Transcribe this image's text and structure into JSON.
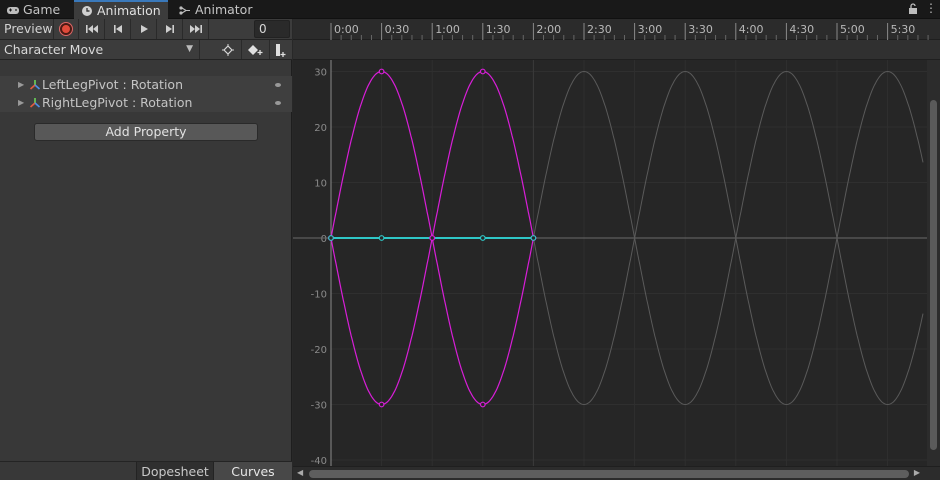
{
  "tabs": [
    {
      "label": "Game",
      "icon": "gamepad-icon",
      "active": false
    },
    {
      "label": "Animation",
      "icon": "clock-icon",
      "active": true
    },
    {
      "label": "Animator",
      "icon": "animator-graph-icon",
      "active": false
    }
  ],
  "window_menu": "⋮",
  "controls": {
    "preview_label": "Preview",
    "frame_value": "0",
    "buttons": [
      "record-icon",
      "first-keyframe-icon",
      "previous-keyframe-icon",
      "play-icon",
      "next-keyframe-icon",
      "last-keyframe-icon"
    ]
  },
  "clip": {
    "selected": "Character Move",
    "key_buttons": [
      "filter-keyframes-icon",
      "add-keyframe-icon",
      "add-event-icon"
    ]
  },
  "properties": [
    {
      "label": "LeftLegPivot : Rotation",
      "icon": "transform-axes-icon"
    },
    {
      "label": "RightLegPivot : Rotation",
      "icon": "transform-axes-icon"
    }
  ],
  "add_property_label": "Add Property",
  "bottom_tabs": {
    "dopesheet": "Dopesheet",
    "curves": "Curves",
    "active": "Curves"
  },
  "timeline": {
    "labels": [
      "0:00",
      "0:30",
      "1:00",
      "1:30",
      "2:00",
      "2:30",
      "3:00",
      "3:30",
      "4:00",
      "4:30",
      "5:00",
      "5:30"
    ]
  },
  "y_axis_labels": [
    "30",
    "20",
    "10",
    "0",
    "-10",
    "-20",
    "-30",
    "-40"
  ],
  "chart_data": {
    "type": "line",
    "x_unit": "seconds:frames",
    "clip_end": "2:00",
    "y_axis_range": [
      -40,
      30
    ],
    "series": [
      {
        "color": "#d81ed8",
        "keyframes": [
          {
            "x": "0:00",
            "y": 0
          },
          {
            "x": "0:30",
            "y": 30
          },
          {
            "x": "1:00",
            "y": 0
          },
          {
            "x": "1:30",
            "y": 30
          },
          {
            "x": "2:00",
            "y": 0
          }
        ]
      },
      {
        "color": "#d81ed8",
        "keyframes": [
          {
            "x": "0:00",
            "y": 0
          },
          {
            "x": "0:30",
            "y": -30
          },
          {
            "x": "1:00",
            "y": 0
          },
          {
            "x": "1:30",
            "y": -30
          },
          {
            "x": "2:00",
            "y": 0
          }
        ]
      },
      {
        "color": "#2fc7c7",
        "keyframes": [
          {
            "x": "0:00",
            "y": 0
          },
          {
            "x": "0:30",
            "y": 0
          },
          {
            "x": "1:30",
            "y": 0
          },
          {
            "x": "2:00",
            "y": 0
          }
        ]
      }
    ],
    "loop_preview_color": "#5a5a5a",
    "grid": true
  }
}
